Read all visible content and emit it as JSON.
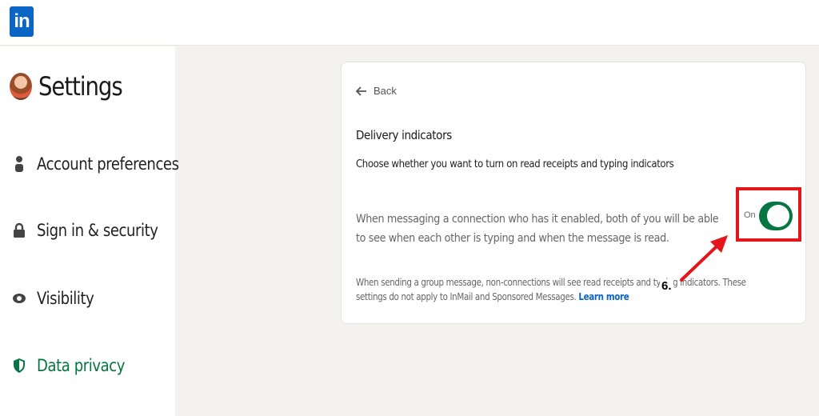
{
  "app": {
    "logo_text": "in"
  },
  "sidebar": {
    "title": "Settings",
    "items": [
      {
        "label": "Account preferences",
        "icon": "person-icon"
      },
      {
        "label": "Sign in & security",
        "icon": "lock-icon"
      },
      {
        "label": "Visibility",
        "icon": "eye-icon"
      },
      {
        "label": "Data privacy",
        "icon": "shield-icon",
        "active": true
      }
    ]
  },
  "card": {
    "back_label": "Back",
    "heading": "Delivery indicators",
    "subheading": "Choose whether you want to turn on read receipts and typing indicators",
    "description": "When messaging a connection who has it enabled, both of you will be able to see when each other is typing and when the message is read.",
    "toggle_label": "On",
    "toggle_on": true,
    "note_text": "When sending a group message, non-connections will see read receipts and typing indicators. These settings do not apply to InMail and Sponsored Messages.",
    "learn_more": "Learn more"
  },
  "annotation": {
    "step": "6."
  },
  "colors": {
    "brand": "#0a66c2",
    "toggle_on": "#057642",
    "active_nav": "#057642",
    "highlight": "#e4161b"
  }
}
